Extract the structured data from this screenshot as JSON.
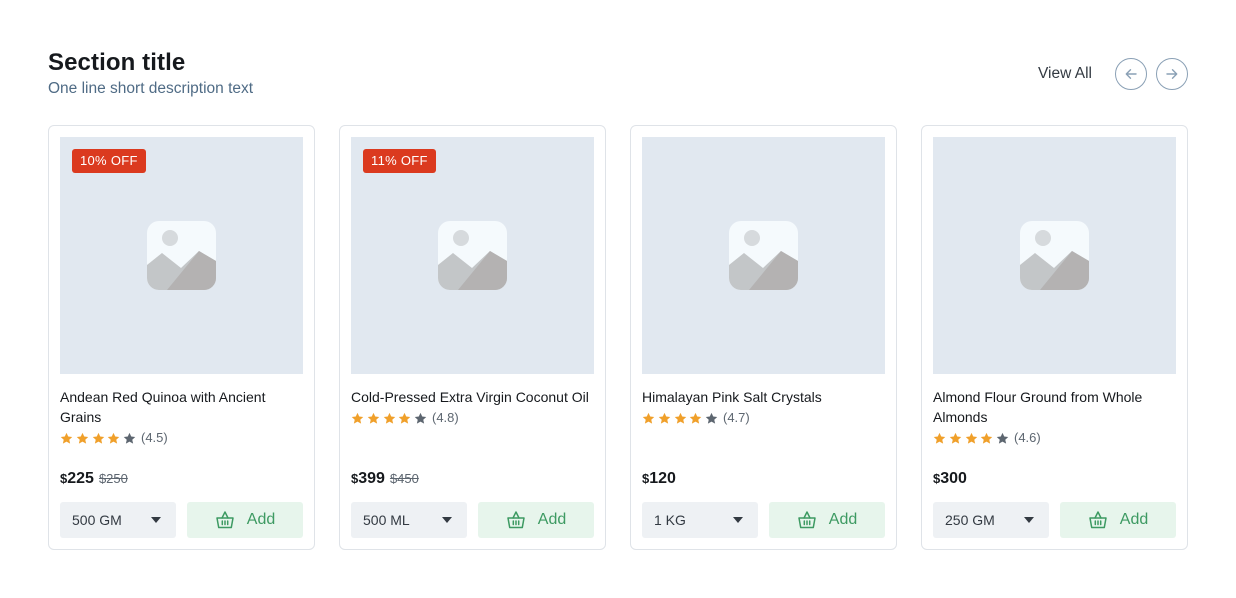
{
  "section": {
    "title": "Section title",
    "description": "One line short description text",
    "view_all": "View All"
  },
  "colors": {
    "badge": "#db3a1f",
    "star_filled": "#f0a02b",
    "star_empty": "#5d6670",
    "add_text": "#3d9a62",
    "add_bg": "#e7f5ec",
    "image_bg": "#e1e8f0"
  },
  "products": [
    {
      "badge": "10% OFF",
      "name": "Andean Red Quinoa with Ancient Grains",
      "stars_filled": 4,
      "rating": "(4.5)",
      "currency": "$",
      "price": "225",
      "old_price": "$250",
      "variant": "500 GM",
      "add_label": "Add"
    },
    {
      "badge": "11% OFF",
      "name": "Cold-Pressed Extra Virgin Coconut Oil",
      "stars_filled": 4,
      "rating": "(4.8)",
      "currency": "$",
      "price": "399",
      "old_price": "$450",
      "variant": "500 ML",
      "add_label": "Add"
    },
    {
      "badge": "",
      "name": "Himalayan Pink Salt Crystals",
      "stars_filled": 4,
      "rating": "(4.7)",
      "currency": "$",
      "price": "120",
      "old_price": "",
      "variant": "1 KG",
      "add_label": "Add"
    },
    {
      "badge": "",
      "name": "Almond Flour Ground from Whole Almonds",
      "stars_filled": 4,
      "rating": "(4.6)",
      "currency": "$",
      "price": "300",
      "old_price": "",
      "variant": "250 GM",
      "add_label": "Add"
    }
  ]
}
